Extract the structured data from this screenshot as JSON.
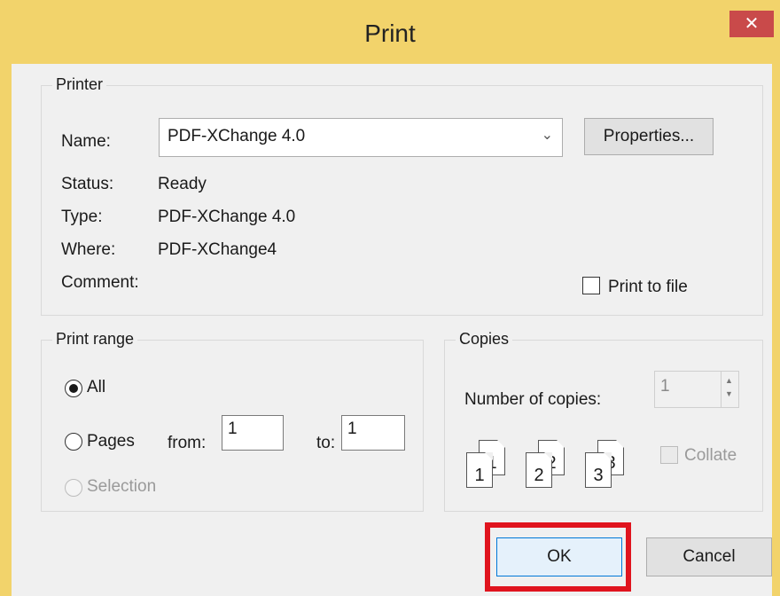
{
  "window": {
    "title": "Print",
    "close_glyph": "✕"
  },
  "printer": {
    "group_label": "Printer",
    "name_label": "Name:",
    "name_value": "PDF-XChange 4.0",
    "properties_button": "Properties...",
    "status_label": "Status:",
    "status_value": "Ready",
    "type_label": "Type:",
    "type_value": "PDF-XChange 4.0",
    "where_label": "Where:",
    "where_value": "PDF-XChange4",
    "comment_label": "Comment:",
    "print_to_file_label": "Print to file"
  },
  "range": {
    "group_label": "Print range",
    "all_label": "All",
    "pages_label": "Pages",
    "from_label": "from:",
    "from_value": "1",
    "to_label": "to:",
    "to_value": "1",
    "selection_label": "Selection"
  },
  "copies": {
    "group_label": "Copies",
    "number_label": "Number of copies:",
    "number_value": "1",
    "collate_label": "Collate",
    "collate_icons": [
      {
        "back": "1",
        "front": "1"
      },
      {
        "back": "2",
        "front": "2"
      },
      {
        "back": "3",
        "front": "3"
      }
    ]
  },
  "buttons": {
    "ok": "OK",
    "cancel": "Cancel"
  },
  "colors": {
    "titlebar": "#f2d36b",
    "close": "#c94a4a",
    "highlight": "#e0141e"
  },
  "icons": [
    "close-icon",
    "chevron-down-icon",
    "spin-up-icon",
    "spin-down-icon"
  ]
}
